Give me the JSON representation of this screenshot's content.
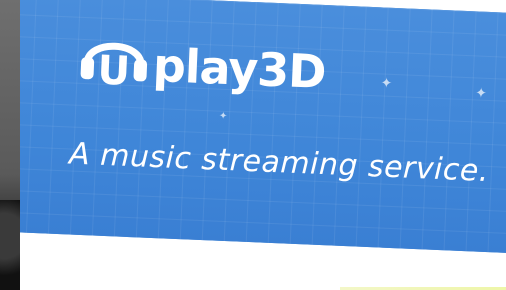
{
  "hero": {
    "brand_letter": "U",
    "brand_name": "play3D",
    "tagline": "A music streaming service."
  },
  "colors": {
    "banner_blue": "#3f86d8",
    "text_white": "#ffffff",
    "page_white": "#ffffff"
  },
  "icons": {
    "logo": "headphones-icon",
    "sparkle": "sparkle-icon"
  }
}
